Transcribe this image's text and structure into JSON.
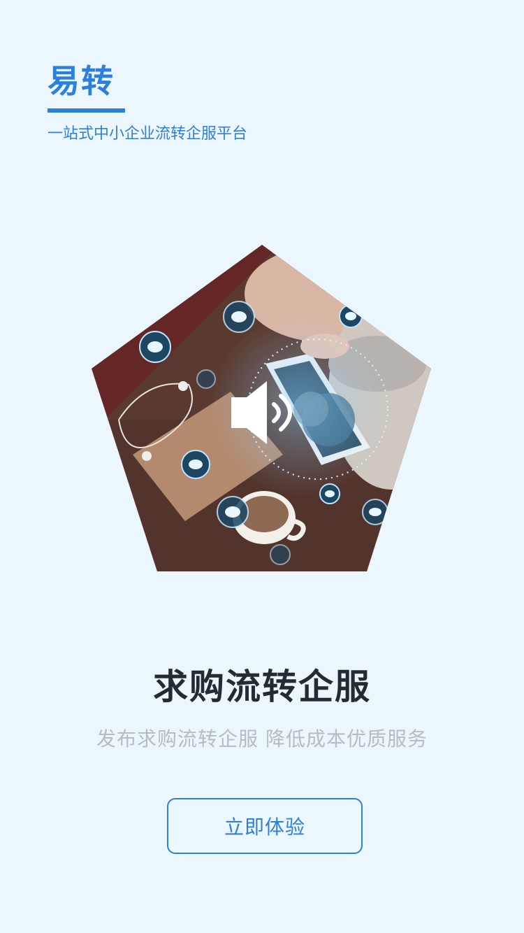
{
  "header": {
    "brand": "易转",
    "tagline": "一站式中小企业流转企服平台"
  },
  "main": {
    "headline": "求购流转企服",
    "subline": "发布求购流转企服 降低成本优质服务"
  },
  "cta": {
    "label": "立即体验"
  },
  "icons": [
    "speaker-icon",
    "chat-bubble-icon"
  ],
  "colors": {
    "background": "#ecf6fd",
    "accent": "#2d7fdd",
    "headline": "#262b31",
    "subline": "#b6bcc3"
  }
}
